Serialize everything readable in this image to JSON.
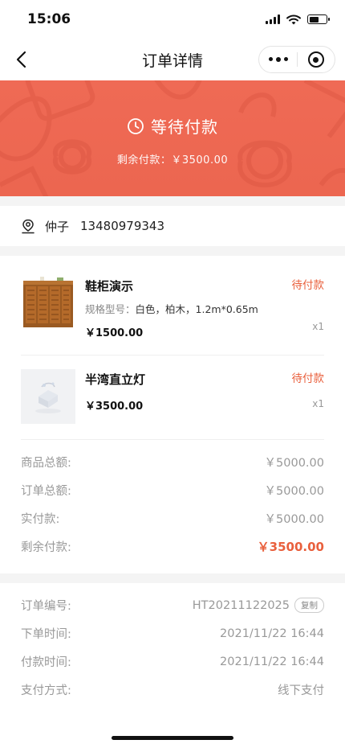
{
  "status_bar": {
    "time": "15:06"
  },
  "nav": {
    "title": "订单详情"
  },
  "banner": {
    "status": "等待付款",
    "remaining": "剩余付款：￥3500.00"
  },
  "contact": {
    "name": "仲子",
    "phone": "13480979343"
  },
  "items": [
    {
      "name": "鞋柜演示",
      "spec_label": "规格型号：",
      "spec_value": "白色，柏木，1.2m*0.65m",
      "price": "￥1500.00",
      "status": "待付款",
      "qty": "x1"
    },
    {
      "name": "半湾直立灯",
      "price": "￥3500.00",
      "status": "待付款",
      "qty": "x1"
    }
  ],
  "summary": [
    {
      "label": "商品总额:",
      "value": "￥5000.00"
    },
    {
      "label": "订单总额:",
      "value": "￥5000.00"
    },
    {
      "label": "实付款:",
      "value": "￥5000.00"
    },
    {
      "label": "剩余付款:",
      "value": "￥3500.00"
    }
  ],
  "order_info": {
    "number_label": "订单编号:",
    "number": "HT20211122025",
    "copy_label": "复制",
    "order_time_label": "下单时间:",
    "order_time": "2021/11/22 16:44",
    "pay_time_label": "付款时间:",
    "pay_time": "2021/11/22 16:44",
    "pay_method_label": "支付方式:",
    "pay_method": "线下支付"
  },
  "colors": {
    "accent": "#e9603d",
    "banner": "#ec6650"
  }
}
